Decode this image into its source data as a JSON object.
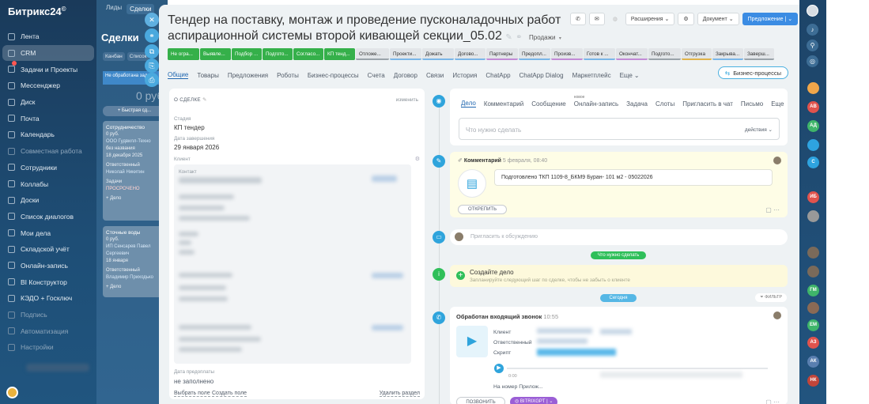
{
  "app": {
    "name": "Битрикс24",
    "logo_suffix": "©"
  },
  "sidebar": {
    "items": [
      {
        "label": "Лента"
      },
      {
        "label": "CRM",
        "active": true
      },
      {
        "label": "Задачи и Проекты",
        "badge": true
      },
      {
        "label": "Мессенджер"
      },
      {
        "label": "Диск"
      },
      {
        "label": "Почта"
      },
      {
        "label": "Календарь"
      },
      {
        "label": "Совместная работа",
        "dim": true
      },
      {
        "label": "Сотрудники"
      },
      {
        "label": "Коллабы"
      },
      {
        "label": "Доски"
      },
      {
        "label": "Список диалогов"
      },
      {
        "label": "Мои дела"
      },
      {
        "label": "Складской учёт"
      },
      {
        "label": "Онлайн-запись"
      },
      {
        "label": "BI Конструктор"
      },
      {
        "label": "КЭДО + Госключ"
      },
      {
        "label": "Подпись",
        "dim": true
      },
      {
        "label": "Автоматизация",
        "dim": true
      },
      {
        "label": "Настройки",
        "dim": true
      }
    ]
  },
  "board": {
    "tabs": [
      "Лиды",
      "Сделки"
    ],
    "title": "Сделки",
    "view_tabs": [
      "Канбан",
      "Список"
    ],
    "column_header": "Не обработана задача",
    "column_sum": "0 руб.",
    "quick_add": "+ Быстрая сд...",
    "cards": [
      {
        "title": "Сотрудничество",
        "price": "0 руб.",
        "company": "ООО Гудвилл-Техно",
        "note": "без названия",
        "date": "18 декабря 2025",
        "resp_label": "Ответственный",
        "resp": "Николай Никитин",
        "task_label": "Задачи",
        "task": "ПРОСРОЧЕНО",
        "add": "+ Дело"
      },
      {
        "title": "Сточные воды",
        "price": "0 руб.",
        "company": "ИП Сенсарев Павел Сергеевич",
        "note": "18 января",
        "date": "",
        "resp_label": "Ответственный",
        "resp": "Владимир Приходько",
        "task_label": "",
        "task": "",
        "add": "+ Дело"
      }
    ]
  },
  "deal": {
    "title": "Тендер на поставку, монтаж и проведение пусконаладочных работ аспирационной системы второй кивающей секции_05.02",
    "funnel": "Продажи",
    "toolbar": {
      "extensions": "Расширения",
      "document": "Документ",
      "offer": "Предложение"
    },
    "stages": [
      {
        "label": "Не огра...",
        "done": true,
        "bar": "#35b04a"
      },
      {
        "label": "Выявле...",
        "done": true,
        "bar": "#35b04a"
      },
      {
        "label": "Подбор ...",
        "done": true,
        "bar": "#35b04a"
      },
      {
        "label": "Подгото...",
        "done": true,
        "bar": "#35b04a"
      },
      {
        "label": "Согласо...",
        "done": true,
        "bar": "#35b04a"
      },
      {
        "label": "КП тенд...",
        "done": true,
        "bar": "#35b04a"
      },
      {
        "label": "Отложе...",
        "done": false,
        "bar": "#9aa3aa"
      },
      {
        "label": "Проекти...",
        "done": false,
        "bar": "#7ab6e8"
      },
      {
        "label": "Дожать",
        "done": false,
        "bar": "#7ab6e8"
      },
      {
        "label": "Догово...",
        "done": false,
        "bar": "#7ab6e8"
      },
      {
        "label": "Партнеры",
        "done": false,
        "bar": "#c28bd6"
      },
      {
        "label": "Предопл...",
        "done": false,
        "bar": "#7ab6e8"
      },
      {
        "label": "Произв...",
        "done": false,
        "bar": "#c28bd6"
      },
      {
        "label": "Готов к ...",
        "done": false,
        "bar": "#7ab6e8"
      },
      {
        "label": "Окончат...",
        "done": false,
        "bar": "#c28bd6"
      },
      {
        "label": "Подгото...",
        "done": false,
        "bar": "#9aa3aa"
      },
      {
        "label": "Отгрузка",
        "done": false,
        "bar": "#e0b34a"
      },
      {
        "label": "Закрыва...",
        "done": false,
        "bar": "#7ab6e8"
      },
      {
        "label": "Заверш...",
        "done": false,
        "bar": "#9aa3aa"
      }
    ],
    "tabs": [
      "Общие",
      "Товары",
      "Предложения",
      "Роботы",
      "Бизнес-процессы",
      "Счета",
      "Договор",
      "Связи",
      "История",
      "ChatApp",
      "ChatApp Dialog",
      "Маркетплейс",
      "Еще"
    ],
    "bp_button": "Бизнес-процессы",
    "about": {
      "header": "О СДЕЛКЕ",
      "edit": "изменить",
      "stage_label": "Стадия",
      "stage_value": "КП тендер",
      "close_label": "Дата завершения",
      "close_value": "29 января 2026",
      "client_label": "Клиент",
      "contact_label": "Контакт",
      "prepay_label": "Дата предоплаты",
      "prepay_value": "не заполнено",
      "select_field": "Выбрать поле",
      "create_field": "Создать поле",
      "delete_section": "Удалить раздел"
    }
  },
  "timeline": {
    "tabs": [
      "Дело",
      "Комментарий",
      "Сообщение",
      "Онлайн-запись",
      "Задача",
      "Слоты",
      "Пригласить в чат",
      "Письмо",
      "Еще"
    ],
    "new_badge": "новое",
    "input_placeholder": "Что нужно сделать",
    "actions": "действия",
    "comment": {
      "title": "Комментарий",
      "date": "5 февраля, 08:40",
      "text": "Подготовлено ТКП 1109-8_БКМ9 Буран- 101 м2 - 05022026",
      "unpin": "ОТКРЕПИТЬ"
    },
    "invite": "Пригласить к обсуждению",
    "todo_pill": "Что нужно сделать",
    "create": {
      "title": "Создайте дело",
      "sub": "Запланируйте следующий шаг по сделке, чтобы не забыть о клиенте"
    },
    "today_pill": "Сегодня",
    "filter": "ФИЛЬТР",
    "call": {
      "title": "Обработан входящий звонок",
      "time": "10:55",
      "client": "Клиент",
      "resp": "Ответственный",
      "script": "Скрипт",
      "time0": "0:00",
      "number": "На номер Прилож...",
      "call_btn": "ПОЗВОНИТЬ",
      "gpt_btn": "BITRIXGPT"
    }
  },
  "right_bar": {
    "avatars": [
      {
        "initials": "",
        "color": "#f0a64a"
      },
      {
        "initials": "АВ",
        "color": "#e0534d"
      },
      {
        "initials": "АД",
        "color": "#3fb56a"
      },
      {
        "initials": "",
        "color": "#2ea3e0"
      },
      {
        "initials": "С",
        "color": "#2ea3e0"
      },
      {
        "initials": "ИБ",
        "color": "#e0534d"
      },
      {
        "initials": "",
        "color": "#999"
      },
      {
        "initials": "",
        "color": "#7a6a5a"
      },
      {
        "initials": "",
        "color": "#7a6a5a"
      },
      {
        "initials": "ГМ",
        "color": "#3fb56a"
      },
      {
        "initials": "",
        "color": "#8a6a55"
      },
      {
        "initials": "ЕМ",
        "color": "#3fb56a"
      },
      {
        "initials": "АЗ",
        "color": "#e0534d"
      },
      {
        "initials": "АК",
        "color": "#5a7fb0"
      },
      {
        "initials": "НК",
        "color": "#c2453a"
      }
    ]
  }
}
